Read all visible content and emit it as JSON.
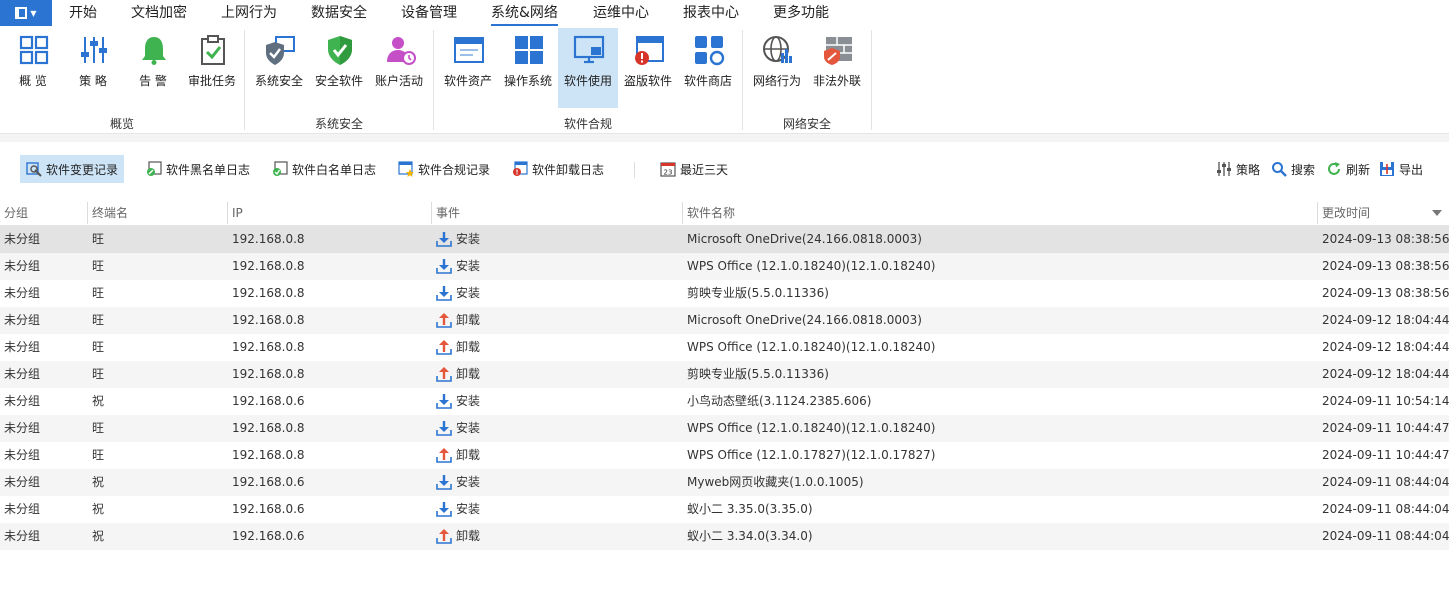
{
  "menu": {
    "tabs": [
      "开始",
      "文档加密",
      "上网行为",
      "数据安全",
      "设备管理",
      "系统&网络",
      "运维中心",
      "报表中心",
      "更多功能"
    ],
    "active": "系统&网络"
  },
  "ribbon": {
    "buttons": [
      {
        "label": "概  览",
        "icon": "overview-icon"
      },
      {
        "label": "策  略",
        "icon": "policy-sliders-icon"
      },
      {
        "label": "告  警",
        "icon": "alarm-bell-icon"
      },
      {
        "label": "审批任务",
        "icon": "approval-clipboard-icon"
      },
      {
        "label": "系统安全",
        "icon": "system-security-shield-icon"
      },
      {
        "label": "安全软件",
        "icon": "security-software-shield-icon"
      },
      {
        "label": "账户活动",
        "icon": "account-activity-user-icon"
      },
      {
        "label": "软件资产",
        "icon": "software-asset-window-icon"
      },
      {
        "label": "操作系统",
        "icon": "windows-logo-icon"
      },
      {
        "label": "软件使用",
        "icon": "software-usage-monitor-icon"
      },
      {
        "label": "盗版软件",
        "icon": "pirated-software-icon"
      },
      {
        "label": "软件商店",
        "icon": "software-store-icon"
      },
      {
        "label": "网络行为",
        "icon": "network-globe-icon"
      },
      {
        "label": "非法外联",
        "icon": "firewall-icon"
      }
    ],
    "groups": [
      "概览",
      "系统安全",
      "软件合规",
      "网络安全"
    ]
  },
  "toolbar": {
    "tabs": [
      {
        "label": "软件变更记录",
        "icon": "software-change-icon"
      },
      {
        "label": "软件黑名单日志",
        "icon": "blacklist-icon"
      },
      {
        "label": "软件白名单日志",
        "icon": "whitelist-icon"
      },
      {
        "label": "软件合规记录",
        "icon": "compliance-icon"
      },
      {
        "label": "软件卸载日志",
        "icon": "uninstall-log-icon"
      }
    ],
    "date_filter": {
      "label": "最近三天",
      "icon": "calendar-icon",
      "day": "23"
    },
    "actions": [
      {
        "label": "策略",
        "icon": "policy-icon"
      },
      {
        "label": "搜索",
        "icon": "search-icon"
      },
      {
        "label": "刷新",
        "icon": "refresh-icon"
      },
      {
        "label": "导出",
        "icon": "export-icon"
      }
    ]
  },
  "table": {
    "columns": [
      "分组",
      "终端名",
      "IP",
      "事件",
      "软件名称",
      "更改时间"
    ],
    "rows": [
      {
        "group": "未分组",
        "terminal": "旺",
        "ip": "192.168.0.8",
        "event": "安装",
        "event_type": "install",
        "software": "Microsoft OneDrive(24.166.0818.0003)",
        "time": "2024-09-13 08:38:56"
      },
      {
        "group": "未分组",
        "terminal": "旺",
        "ip": "192.168.0.8",
        "event": "安装",
        "event_type": "install",
        "software": "WPS Office (12.1.0.18240)(12.1.0.18240)",
        "time": "2024-09-13 08:38:56"
      },
      {
        "group": "未分组",
        "terminal": "旺",
        "ip": "192.168.0.8",
        "event": "安装",
        "event_type": "install",
        "software": "剪映专业版(5.5.0.11336)",
        "time": "2024-09-13 08:38:56"
      },
      {
        "group": "未分组",
        "terminal": "旺",
        "ip": "192.168.0.8",
        "event": "卸载",
        "event_type": "uninstall",
        "software": "Microsoft OneDrive(24.166.0818.0003)",
        "time": "2024-09-12 18:04:44"
      },
      {
        "group": "未分组",
        "terminal": "旺",
        "ip": "192.168.0.8",
        "event": "卸载",
        "event_type": "uninstall",
        "software": "WPS Office (12.1.0.18240)(12.1.0.18240)",
        "time": "2024-09-12 18:04:44"
      },
      {
        "group": "未分组",
        "terminal": "旺",
        "ip": "192.168.0.8",
        "event": "卸载",
        "event_type": "uninstall",
        "software": "剪映专业版(5.5.0.11336)",
        "time": "2024-09-12 18:04:44"
      },
      {
        "group": "未分组",
        "terminal": "祝",
        "ip": "192.168.0.6",
        "event": "安装",
        "event_type": "install",
        "software": "小鸟动态壁纸(3.1124.2385.606)",
        "time": "2024-09-11 10:54:14"
      },
      {
        "group": "未分组",
        "terminal": "旺",
        "ip": "192.168.0.8",
        "event": "安装",
        "event_type": "install",
        "software": "WPS Office (12.1.0.18240)(12.1.0.18240)",
        "time": "2024-09-11 10:44:47"
      },
      {
        "group": "未分组",
        "terminal": "旺",
        "ip": "192.168.0.8",
        "event": "卸载",
        "event_type": "uninstall",
        "software": "WPS Office (12.1.0.17827)(12.1.0.17827)",
        "time": "2024-09-11 10:44:47"
      },
      {
        "group": "未分组",
        "terminal": "祝",
        "ip": "192.168.0.6",
        "event": "安装",
        "event_type": "install",
        "software": "Myweb网页收藏夹(1.0.0.1005)",
        "time": "2024-09-11 08:44:04"
      },
      {
        "group": "未分组",
        "terminal": "祝",
        "ip": "192.168.0.6",
        "event": "安装",
        "event_type": "install",
        "software": "蚁小二 3.35.0(3.35.0)",
        "time": "2024-09-11 08:44:04"
      },
      {
        "group": "未分组",
        "terminal": "祝",
        "ip": "192.168.0.6",
        "event": "卸载",
        "event_type": "uninstall",
        "software": "蚁小二 3.34.0(3.34.0)",
        "time": "2024-09-11 08:44:04"
      }
    ]
  },
  "colors": {
    "accent": "#2b74d2",
    "install": "#2b74d2",
    "uninstall": "#e4573d",
    "selected_bg": "#cde4f7"
  }
}
